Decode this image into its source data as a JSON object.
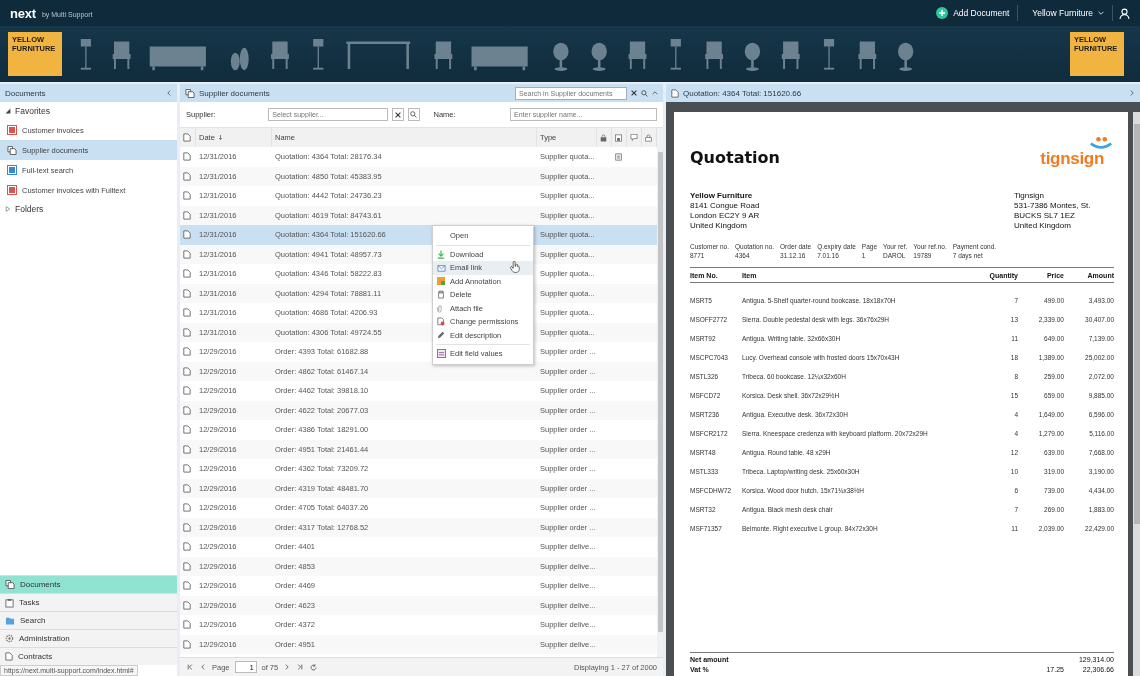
{
  "header": {
    "logo": "next",
    "logo_tagline": "by Multi Support",
    "add_document": "Add Document",
    "account": "Yellow Furniture"
  },
  "banner": {
    "tiles": [
      "YELLOW FURNITURE",
      "YELLOW FURNITURE"
    ]
  },
  "sidebar": {
    "title": "Documents",
    "tree": [
      {
        "label": "Favorites",
        "expanded": true,
        "children": [
          {
            "label": "Customer invoices",
            "selected": false
          },
          {
            "label": "Supplier documents",
            "selected": true
          },
          {
            "label": "Full-text search",
            "selected": false
          },
          {
            "label": "Customer invoices with Fulltext",
            "selected": false
          }
        ]
      },
      {
        "label": "Folders",
        "expanded": false
      }
    ],
    "nav": [
      {
        "label": "Documents",
        "selected": true
      },
      {
        "label": "Tasks",
        "selected": false
      },
      {
        "label": "Search",
        "selected": false
      },
      {
        "label": "Administration",
        "selected": false
      },
      {
        "label": "Contracts",
        "selected": false
      }
    ],
    "status_url": "https://next.multi-support.com/index.html#"
  },
  "list_panel": {
    "title": "Supplier documents",
    "search": {
      "placeholder": "Search in Supplier documents"
    },
    "filters": [
      {
        "kind": "combo",
        "label": "Supplier:",
        "placeholder": "Select supplier..."
      },
      {
        "kind": "text",
        "label": "Name:",
        "placeholder": "Enter supplier name..."
      }
    ],
    "columns": [
      {
        "label": "Date",
        "sort_descending": true
      },
      {
        "label": "Name",
        "sort_descending": false
      },
      {
        "label": "Type",
        "sort_descending": false
      }
    ],
    "rows": [
      {
        "date": "12/31/2016",
        "name": "Quotation: 4364 Total: 28176.34",
        "type": "Supplier quota...",
        "selected": false,
        "has_note": true
      },
      {
        "date": "12/31/2016",
        "name": "Quotation: 4850 Total: 45383.95",
        "type": "Supplier quota...",
        "selected": false,
        "has_note": false
      },
      {
        "date": "12/31/2016",
        "name": "Quotation: 4442 Total: 24736.23",
        "type": "Supplier quota...",
        "selected": false,
        "has_note": false
      },
      {
        "date": "12/31/2016",
        "name": "Quotation: 4619 Total: 84743.61",
        "type": "Supplier quota...",
        "selected": false,
        "has_note": false
      },
      {
        "date": "12/31/2016",
        "name": "Quotation: 4364 Total: 151620.66",
        "type": "Supplier quota...",
        "selected": true,
        "has_note": false
      },
      {
        "date": "12/31/2016",
        "name": "Quotation: 4941 Total: 48957.73",
        "type": "Supplier quota...",
        "selected": false,
        "has_note": false
      },
      {
        "date": "12/31/2016",
        "name": "Quotation: 4346 Total: 58222.83",
        "type": "Supplier quota...",
        "selected": false,
        "has_note": false
      },
      {
        "date": "12/31/2016",
        "name": "Quotation: 4294 Total: 78881.11",
        "type": "Supplier quota...",
        "selected": false,
        "has_note": false
      },
      {
        "date": "12/31/2016",
        "name": "Quotation: 4686 Total: 4206.93",
        "type": "Supplier quota...",
        "selected": false,
        "has_note": false
      },
      {
        "date": "12/31/2016",
        "name": "Quotation: 4306 Total: 49724.55",
        "type": "Supplier quota...",
        "selected": false,
        "has_note": false
      },
      {
        "date": "12/29/2016",
        "name": "Order: 4393 Total: 61682.88",
        "type": "Supplier order ...",
        "selected": false,
        "has_note": false
      },
      {
        "date": "12/29/2016",
        "name": "Order: 4862 Total: 61467.14",
        "type": "Supplier order ...",
        "selected": false,
        "has_note": false
      },
      {
        "date": "12/29/2016",
        "name": "Order: 4462 Total: 39818.10",
        "type": "Supplier order ...",
        "selected": false,
        "has_note": false
      },
      {
        "date": "12/29/2016",
        "name": "Order: 4622 Total: 20677.03",
        "type": "Supplier order ...",
        "selected": false,
        "has_note": false
      },
      {
        "date": "12/29/2016",
        "name": "Order: 4386 Total: 18291.00",
        "type": "Supplier order ...",
        "selected": false,
        "has_note": false
      },
      {
        "date": "12/29/2016",
        "name": "Order: 4951 Total: 21461.44",
        "type": "Supplier order ...",
        "selected": false,
        "has_note": false
      },
      {
        "date": "12/29/2016",
        "name": "Order: 4362 Total: 73209.72",
        "type": "Supplier order ...",
        "selected": false,
        "has_note": false
      },
      {
        "date": "12/29/2016",
        "name": "Order: 4319 Total: 48481.70",
        "type": "Supplier order ...",
        "selected": false,
        "has_note": false
      },
      {
        "date": "12/29/2016",
        "name": "Order: 4705 Total: 64037.26",
        "type": "Supplier order ...",
        "selected": false,
        "has_note": false
      },
      {
        "date": "12/29/2016",
        "name": "Order: 4317 Total: 12768.52",
        "type": "Supplier order ...",
        "selected": false,
        "has_note": false
      },
      {
        "date": "12/29/2016",
        "name": "Order: 4401",
        "type": "Supplier delive...",
        "selected": false,
        "has_note": false
      },
      {
        "date": "12/29/2016",
        "name": "Order: 4853",
        "type": "Supplier delive...",
        "selected": false,
        "has_note": false
      },
      {
        "date": "12/29/2016",
        "name": "Order: 4469",
        "type": "Supplier delive...",
        "selected": false,
        "has_note": false
      },
      {
        "date": "12/29/2016",
        "name": "Order: 4623",
        "type": "Supplier delive...",
        "selected": false,
        "has_note": false
      },
      {
        "date": "12/29/2016",
        "name": "Order: 4372",
        "type": "Supplier delive...",
        "selected": false,
        "has_note": false
      },
      {
        "date": "12/29/2016",
        "name": "Order: 4951",
        "type": "Supplier delive...",
        "selected": false,
        "has_note": false
      }
    ],
    "pager": {
      "page_label": "Page",
      "page": "1",
      "of": "of 75",
      "summary": "Displaying 1 - 27 of 2000"
    }
  },
  "context_menu": {
    "groups": [
      [
        {
          "label": "Open",
          "selected": false
        }
      ],
      [
        {
          "label": "Download",
          "selected": false
        },
        {
          "label": "Email link",
          "selected": true
        },
        {
          "label": "Add Annotation",
          "selected": false
        },
        {
          "label": "Delete",
          "selected": false
        },
        {
          "label": "Attach file",
          "selected": false
        },
        {
          "label": "Change permissions",
          "selected": false
        },
        {
          "label": "Edit description",
          "selected": false
        }
      ],
      [
        {
          "label": "Edit field values",
          "selected": false
        }
      ]
    ]
  },
  "preview": {
    "title": "Quotation: 4364 Total: 151620.66",
    "document": {
      "heading": "Quotation",
      "logo": "tignsign",
      "sender": [
        "Yellow Furniture",
        "8141 Congue Road",
        "London EC2Y 9 AR",
        "United Kingdom"
      ],
      "recipient": [
        "Tignsign",
        "531-7386 Montes, St.",
        "BUCKS SL7 1EZ",
        "United Kingdom"
      ],
      "meta": [
        {
          "label": "Customer no.",
          "value": "8771"
        },
        {
          "label": "Quotation no.",
          "value": "4364"
        },
        {
          "label": "Order date",
          "value": "31.12.16"
        },
        {
          "label": "Q.expiry date",
          "value": "7.01.16"
        },
        {
          "label": "Page",
          "value": "1"
        },
        {
          "label": "Your ref.",
          "value": "DAROL"
        },
        {
          "label": "Your ref.no.",
          "value": "19789"
        },
        {
          "label": "Payment cond.",
          "value": "7 days net"
        }
      ],
      "columns": [
        "Item No.",
        "Item",
        "Quantity",
        "Price",
        "Amount"
      ],
      "items": [
        [
          "MSRT5",
          "Antigua. 5-Shelf quarter-round bookcase. 18x18x70H",
          "7",
          "499.00",
          "3,493.00"
        ],
        [
          "MSOFF2772",
          "Sierra. Double pedestal desk with legs. 36x76x29H",
          "13",
          "2,339.00",
          "30,407.00"
        ],
        [
          "MSRT92",
          "Antigua. Writing table. 32x66x30H",
          "11",
          "649.00",
          "7,139.00"
        ],
        [
          "MSCPC7043",
          "Lucy. Overhead console with frosted doors 15x70x43H",
          "18",
          "1,389.00",
          "25,002.00"
        ],
        [
          "MSTL326",
          "Tribeca. 60 bookcase. 12¼x32x60H",
          "8",
          "259.00",
          "2,072.00"
        ],
        [
          "MSFCD72",
          "Korsica. Desk shell. 36x72x29½H",
          "15",
          "659.00",
          "9,885.00"
        ],
        [
          "MSRT236",
          "Antigua. Executive desk. 36x72x30H",
          "4",
          "1,649.00",
          "6,596.00"
        ],
        [
          "MSFCR2172",
          "Sierra. Kneespace credenza with keyboard platform. 20x72x29H",
          "4",
          "1,279.00",
          "5,116.00"
        ],
        [
          "MSRT48",
          "Antigua. Round table. 48 x29H",
          "12",
          "639.00",
          "7,668.00"
        ],
        [
          "MSTL333",
          "Tribeca. Laptop/writing desk. 25x60x30H",
          "10",
          "319.00",
          "3,190.00"
        ],
        [
          "MSFCDHW72",
          "Korsica. Wood door hutch. 15x71¾x38½H",
          "6",
          "739.00",
          "4,434.00"
        ],
        [
          "MSRT32",
          "Antigua. Black mesh desk chair",
          "7",
          "269.00",
          "1,883.00"
        ],
        [
          "MSF71357",
          "Belmonte. Right executive L group. 84x72x30H",
          "11",
          "2,039.00",
          "22,429.00"
        ]
      ],
      "totals": [
        {
          "label": "Net amount",
          "value": "129,314.00"
        },
        {
          "label": "Vat %",
          "rate": "17.25",
          "value": "22,306.66"
        }
      ]
    }
  }
}
